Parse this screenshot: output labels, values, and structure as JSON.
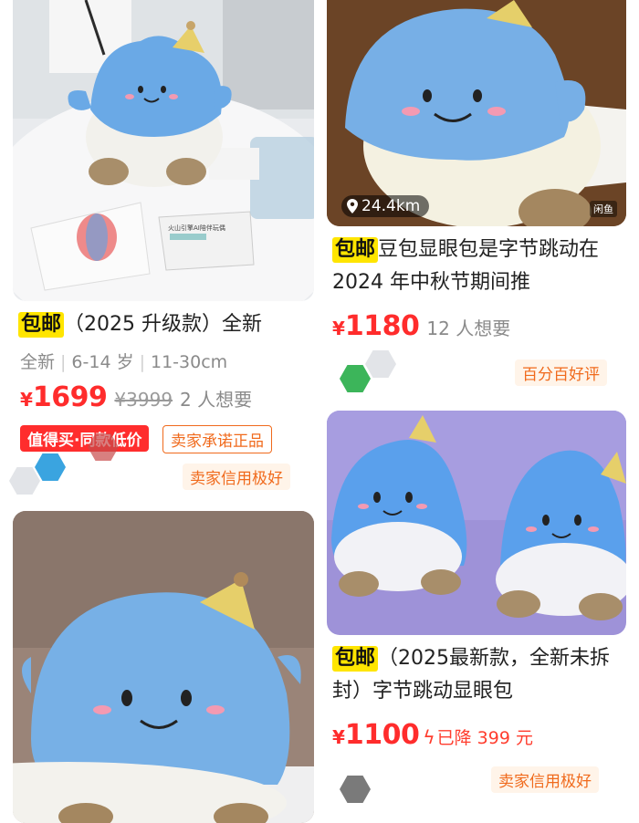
{
  "cards": [
    {
      "free_shipping": "包邮",
      "title": "（2025 升级款）全新",
      "meta": [
        "全新",
        "6-14 岁",
        "11-30cm"
      ],
      "currency": "¥",
      "price": "1699",
      "original_price": "¥3999",
      "want": "2 人想要",
      "badges": [
        "值得买·同款低价",
        "卖家承诺正品"
      ],
      "seller_badge": "卖家信用极好"
    },
    {
      "distance": "24.4km",
      "free_shipping": "包邮",
      "title": "豆包显眼包是字节跳动在 2024 年中秋节期间推",
      "currency": "¥",
      "price": "1180",
      "want": "12 人想要",
      "seller_badge": "百分百好评"
    },
    {
      "free_shipping": "包邮",
      "title": "（2025最新款，全新未拆封）字节跳动显眼包",
      "currency": "¥",
      "price": "1100",
      "drop_text": "已降 399 元",
      "seller_badge": "卖家信用极好"
    }
  ],
  "image_text": {
    "booklet_title": "火山引擎AI陪伴玩偶",
    "corner_logo": "闲鱼"
  },
  "colors": {
    "price_red": "#ff2c2c",
    "tag_yellow": "#ffe500",
    "badge_orange": "#f06a1c",
    "plush_blue": "#6aa9e6",
    "plush_white": "#f4f3ee",
    "plush_feet": "#a88e6a"
  },
  "icons": [
    "location-pin-icon",
    "lightning-icon"
  ]
}
